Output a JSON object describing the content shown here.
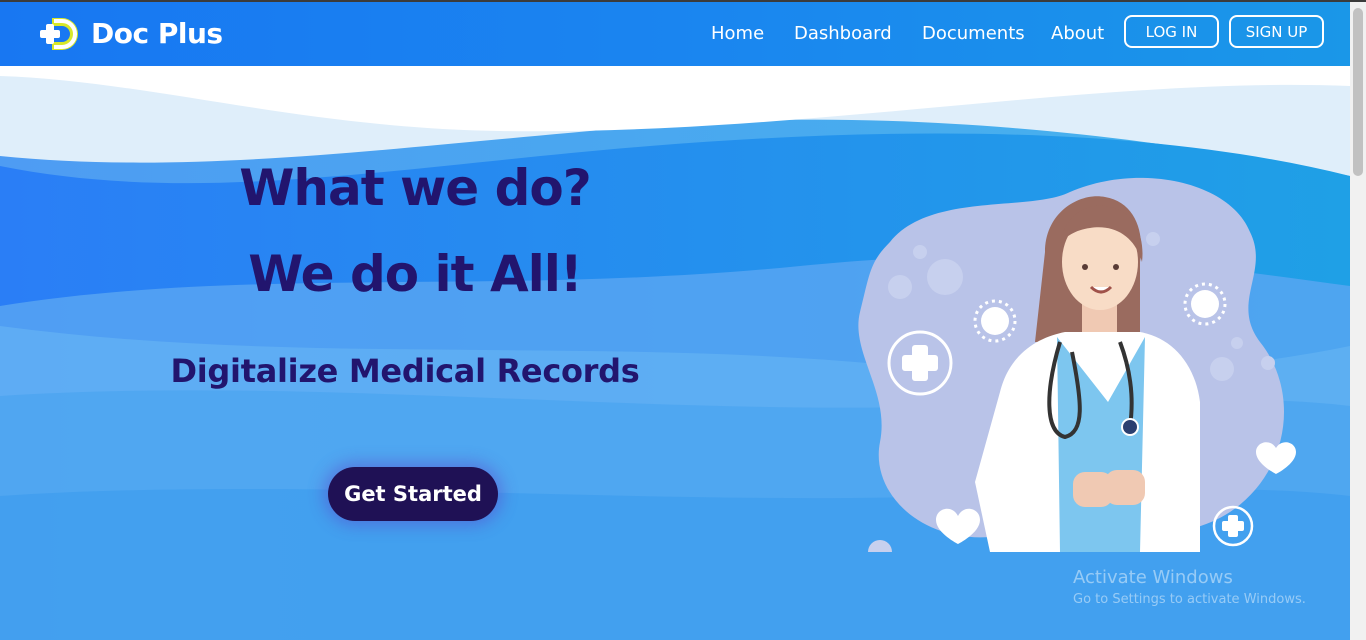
{
  "brand": {
    "name": "Doc Plus",
    "logo_icon": "plus-d-logo-icon"
  },
  "nav": {
    "links": [
      "Home",
      "Dashboard",
      "Documents",
      "About"
    ],
    "login": "LOG IN",
    "signup": "SIGN UP"
  },
  "hero": {
    "title_line1": "What we do?",
    "title_line2": "We do it All!",
    "subtitle": "Digitalize Medical Records",
    "cta": "Get Started",
    "illustration": "doctor-illustration"
  },
  "watermark": {
    "line1": "Activate Windows",
    "line2": "Go to Settings to activate Windows."
  },
  "colors": {
    "nav_bg": "#1877f2",
    "hero_text": "#22156e",
    "cta_bg": "#1f1155",
    "hero_blue": "#3fa3ee"
  }
}
